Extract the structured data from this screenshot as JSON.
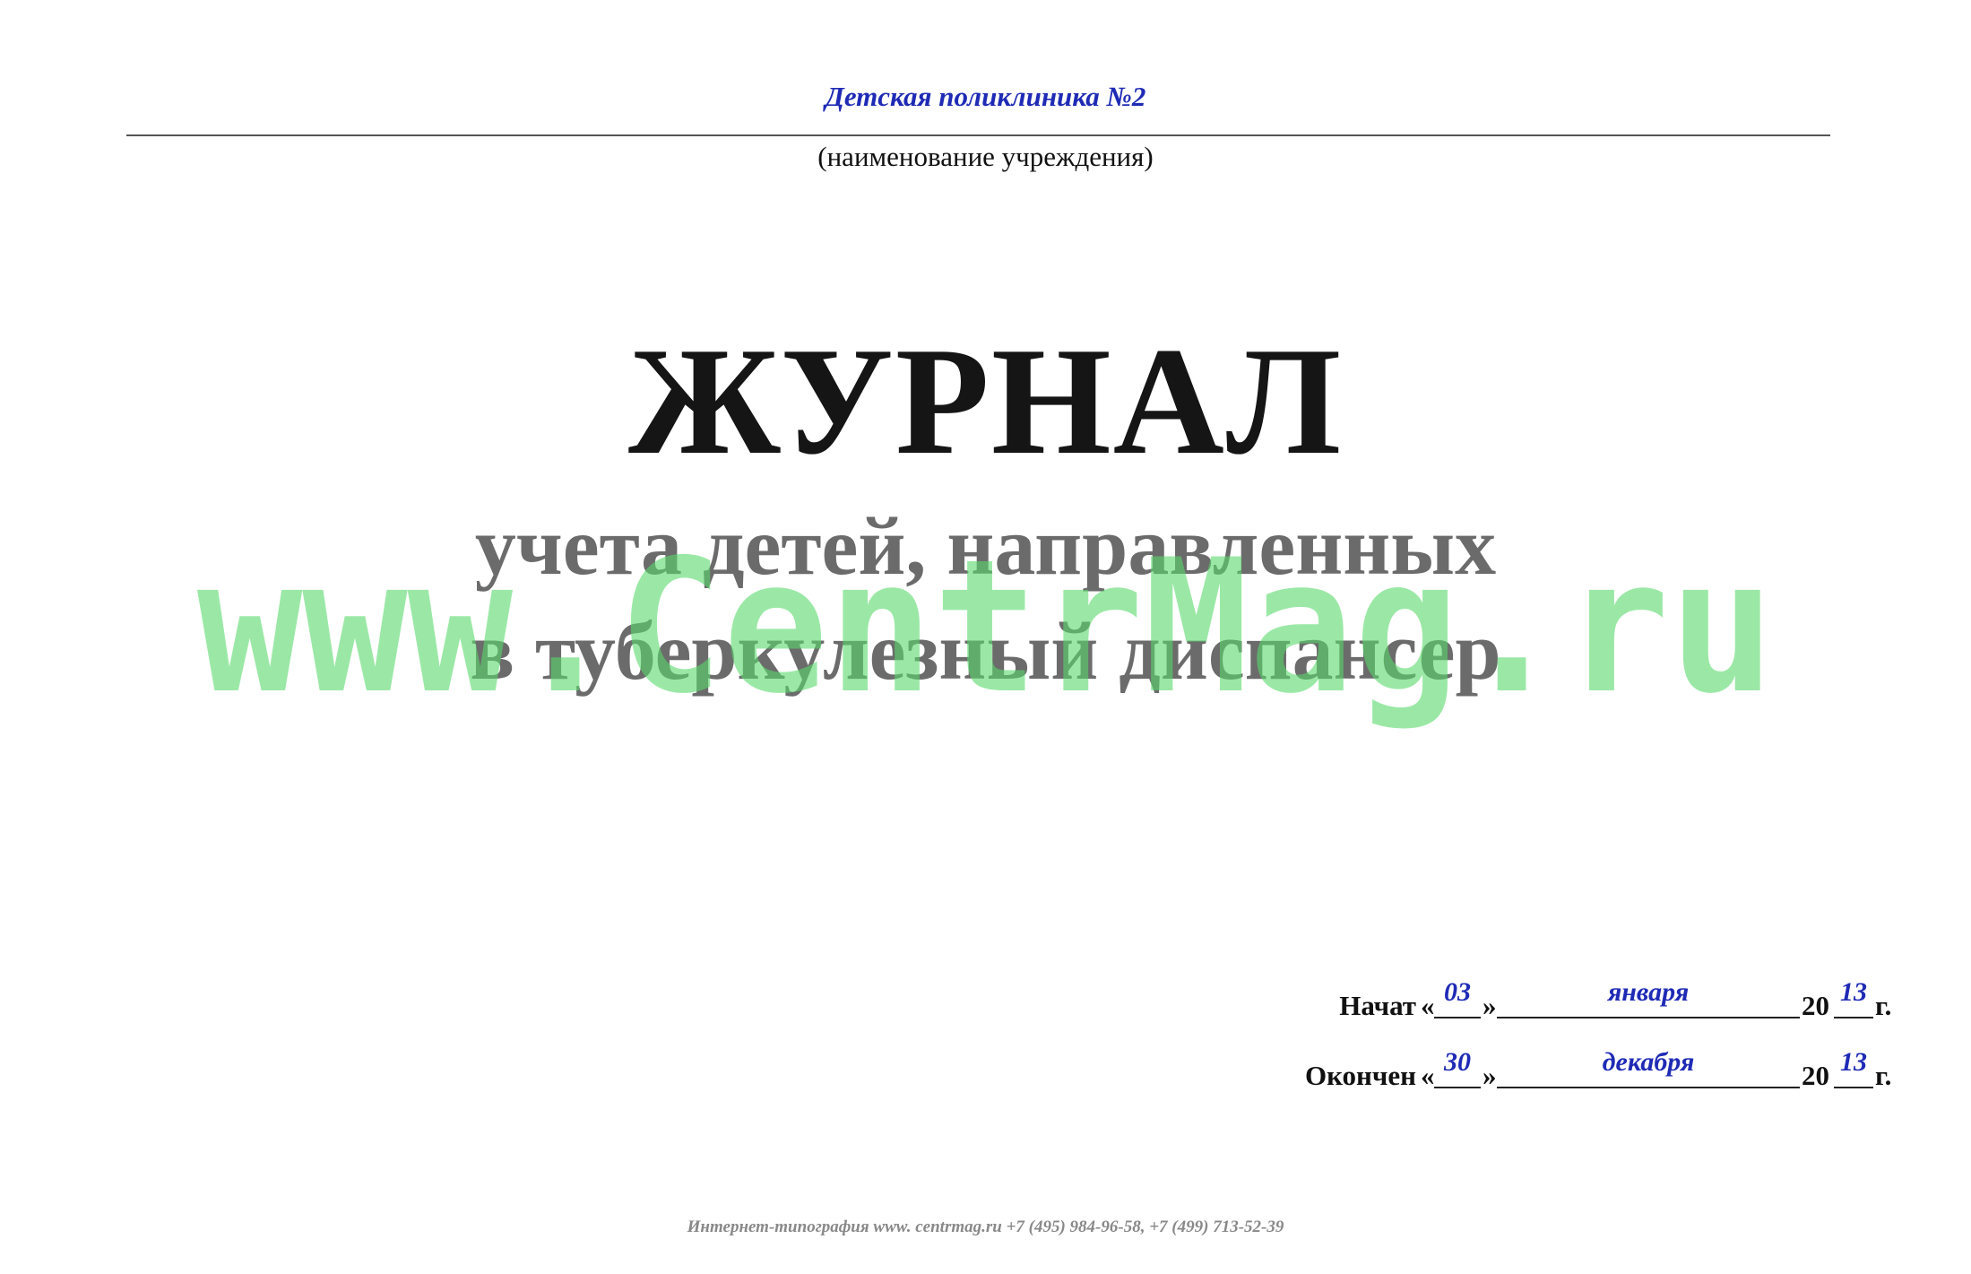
{
  "header": {
    "institution_name": "Детская поликлиника №2",
    "institution_caption": "(наименование учреждения)"
  },
  "title": {
    "main": "ЖУРНАЛ",
    "line1": "учета детей, направленных",
    "line2": "в туберкулезный диспансер"
  },
  "watermark": {
    "text": "www.CentrMag.ru",
    "color": "#59d96a"
  },
  "dates": {
    "started": {
      "label": "Начат",
      "open_quote": "«",
      "close_quote": "»",
      "day": "03",
      "month": "января",
      "century": "20",
      "year": "13",
      "suffix": "г."
    },
    "ended": {
      "label": "Окончен",
      "open_quote": "«",
      "close_quote": "»",
      "day": "30",
      "month": "декабря",
      "century": "20",
      "year": "13",
      "suffix": "г."
    }
  },
  "footer": {
    "text": "Интернет-типография www. centrmag.ru +7 (495) 984-96-58, +7 (499) 713-52-39"
  },
  "colors": {
    "handwriting": "#1f2bb5",
    "title": "#151515",
    "subtitle": "#6b6b6b"
  }
}
